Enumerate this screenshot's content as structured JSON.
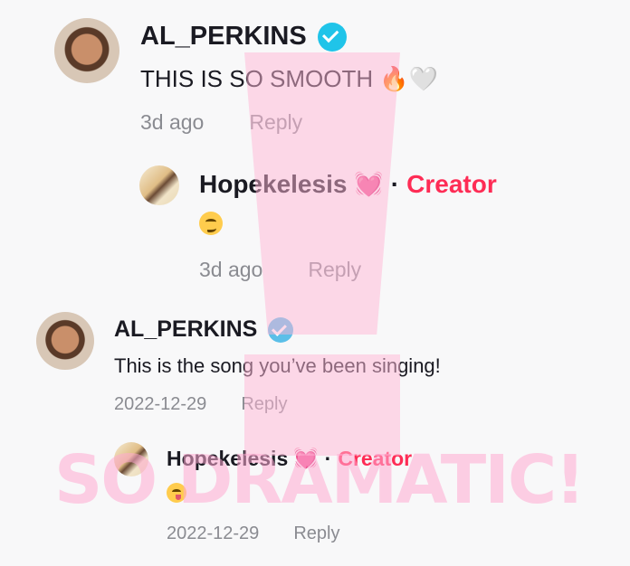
{
  "comments": [
    {
      "username": "AL_PERKINS",
      "text": "THIS IS SO SMOOTH",
      "text_emojis": "🔥🤍",
      "time": "3d ago",
      "reply_label": "Reply",
      "reply": {
        "username": "Hopekelesis",
        "heart": "💓",
        "separator": "·",
        "creator_label": "Creator",
        "emoji": "smirking-face",
        "time": "3d ago",
        "reply_label": "Reply"
      }
    },
    {
      "username": "AL_PERKINS",
      "text": "This is the song you’ve been singing!",
      "time": "2022-12-29",
      "reply_label": "Reply",
      "reply": {
        "username": "Hopekelesis",
        "heart": "💓",
        "separator": "·",
        "creator_label": "Creator",
        "emoji": "yum-face",
        "time": "2022-12-29",
        "reply_label": "Reply"
      }
    }
  ],
  "watermark": "SO DRAMATIC!",
  "colors": {
    "creator": "#fe2c55",
    "verified": "#20c4e9",
    "meta": "#8a8b91"
  }
}
